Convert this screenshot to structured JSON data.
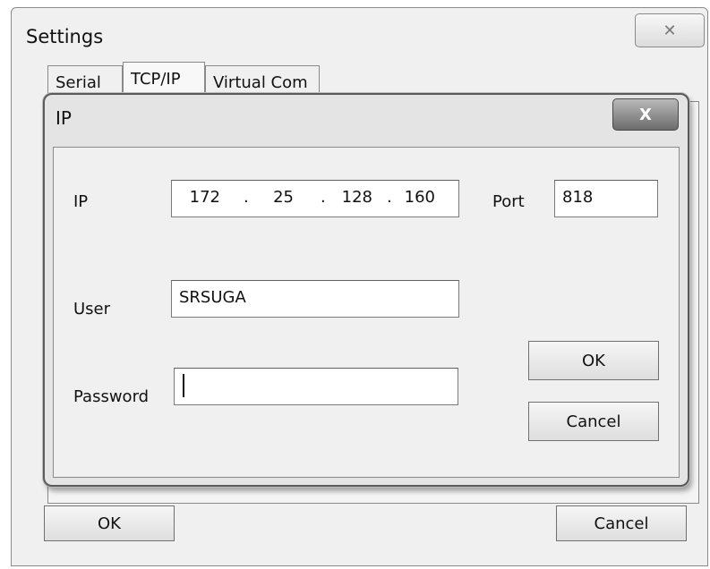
{
  "settings": {
    "title": "Settings",
    "close_glyph": "✕",
    "tabs": [
      {
        "label": "Serial",
        "active": false
      },
      {
        "label": "TCP/IP",
        "active": true
      },
      {
        "label": "Virtual Com",
        "active": false
      }
    ],
    "ok_label": "OK",
    "cancel_label": "Cancel"
  },
  "ip_dialog": {
    "title": "IP",
    "close_glyph": "X",
    "ip_label": "IP",
    "ip_octets": [
      "172",
      "25",
      "128",
      "160"
    ],
    "port_label": "Port",
    "port_value": "818",
    "user_label": "User",
    "user_value": "SRSUGA",
    "password_label": "Password",
    "password_value": "",
    "ok_label": "OK",
    "cancel_label": "Cancel"
  }
}
